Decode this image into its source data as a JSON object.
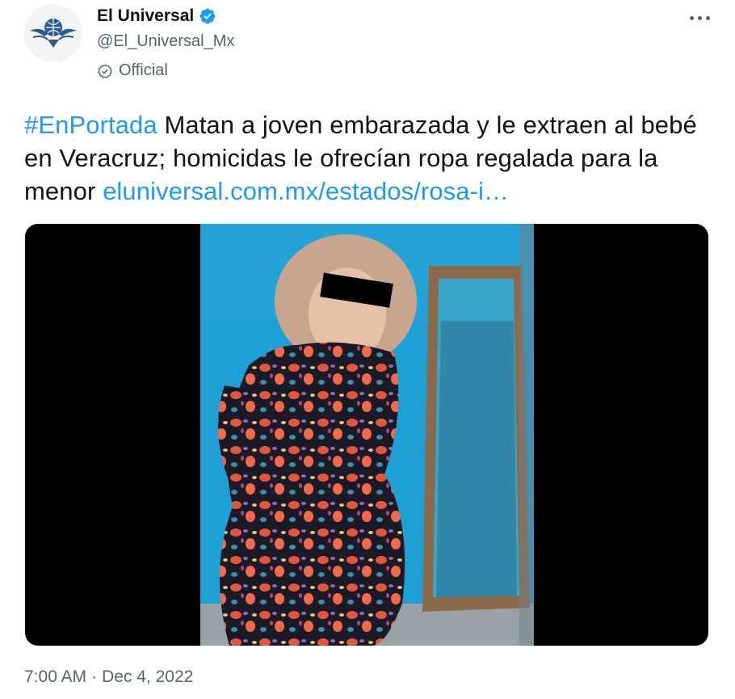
{
  "account": {
    "display_name": "El Universal",
    "handle": "@El_Universal_Mx",
    "official_label": "Official",
    "avatar_icon": "eagle-globe-logo",
    "verified_icon": "verified-badge-icon"
  },
  "menu": {
    "more_icon": "more-dots-icon"
  },
  "tweet": {
    "hashtag": "#EnPortada",
    "text": " Matan a joven embarazada y le extraen al bebé en Veracruz; homicidas le ofrecían ropa regalada para la menor ",
    "link": "eluniversal.com.mx/estados/rosa-i…"
  },
  "media": {
    "type": "photo"
  },
  "meta": {
    "time": "7:00 AM",
    "separator": "·",
    "date": "Dec 4, 2022"
  },
  "colors": {
    "accent": "#1d9bf0",
    "text": "#0f1419",
    "secondary": "#536471",
    "wall": "#1f9fd3",
    "media_bg": "#000000"
  }
}
